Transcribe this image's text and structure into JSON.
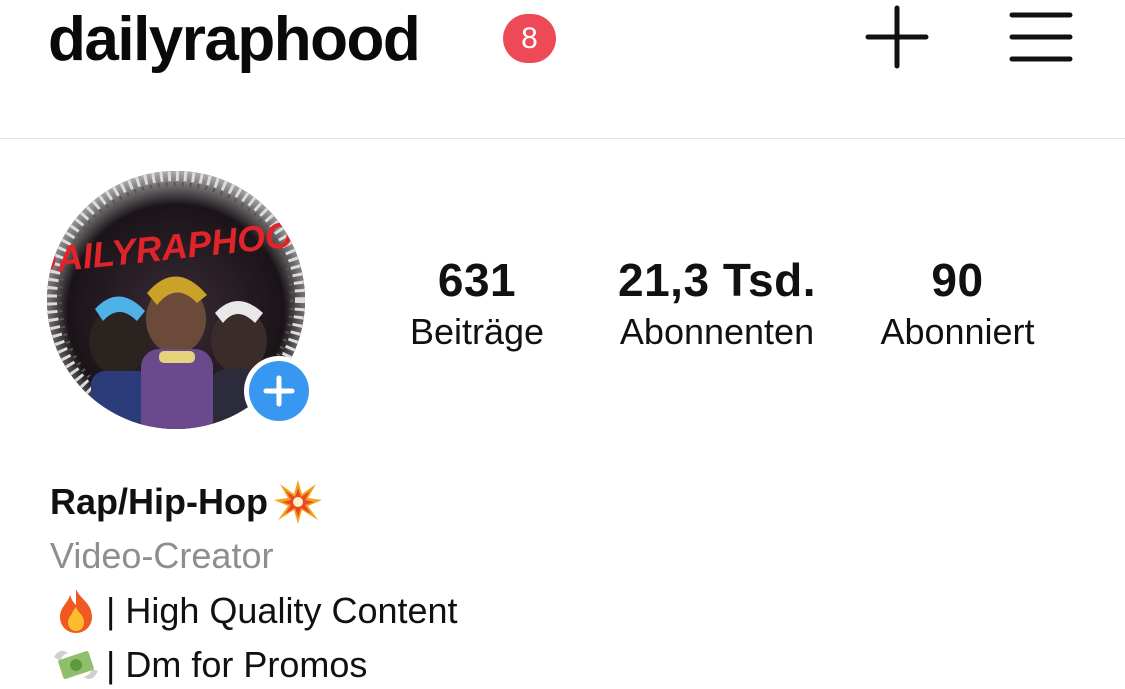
{
  "header": {
    "username": "dailyraphood",
    "notification_count": "8",
    "new_post_icon": "plus-icon",
    "menu_icon": "hamburger-menu-icon"
  },
  "profile": {
    "avatar_text": "DAILYRAPHOOD",
    "add_story_icon": "plus-icon"
  },
  "stats": {
    "posts": {
      "value": "631",
      "label": "Beiträge"
    },
    "followers": {
      "value": "21,3 Tsd.",
      "label": "Abonnenten"
    },
    "following": {
      "value": "90",
      "label": "Abonniert"
    }
  },
  "bio": {
    "name": "Rap/Hip-Hop",
    "name_emoji": "collision-icon",
    "category": "Video-Creator",
    "lines": [
      {
        "emoji": "fire-icon",
        "text": "| High Quality Content"
      },
      {
        "emoji": "money-with-wings-icon",
        "text": "| Dm for Promos"
      }
    ]
  },
  "colors": {
    "badge": "#ed4956",
    "add_story": "#3897f0",
    "category_text": "#8e8e8e",
    "divider": "#e2e2e2"
  }
}
